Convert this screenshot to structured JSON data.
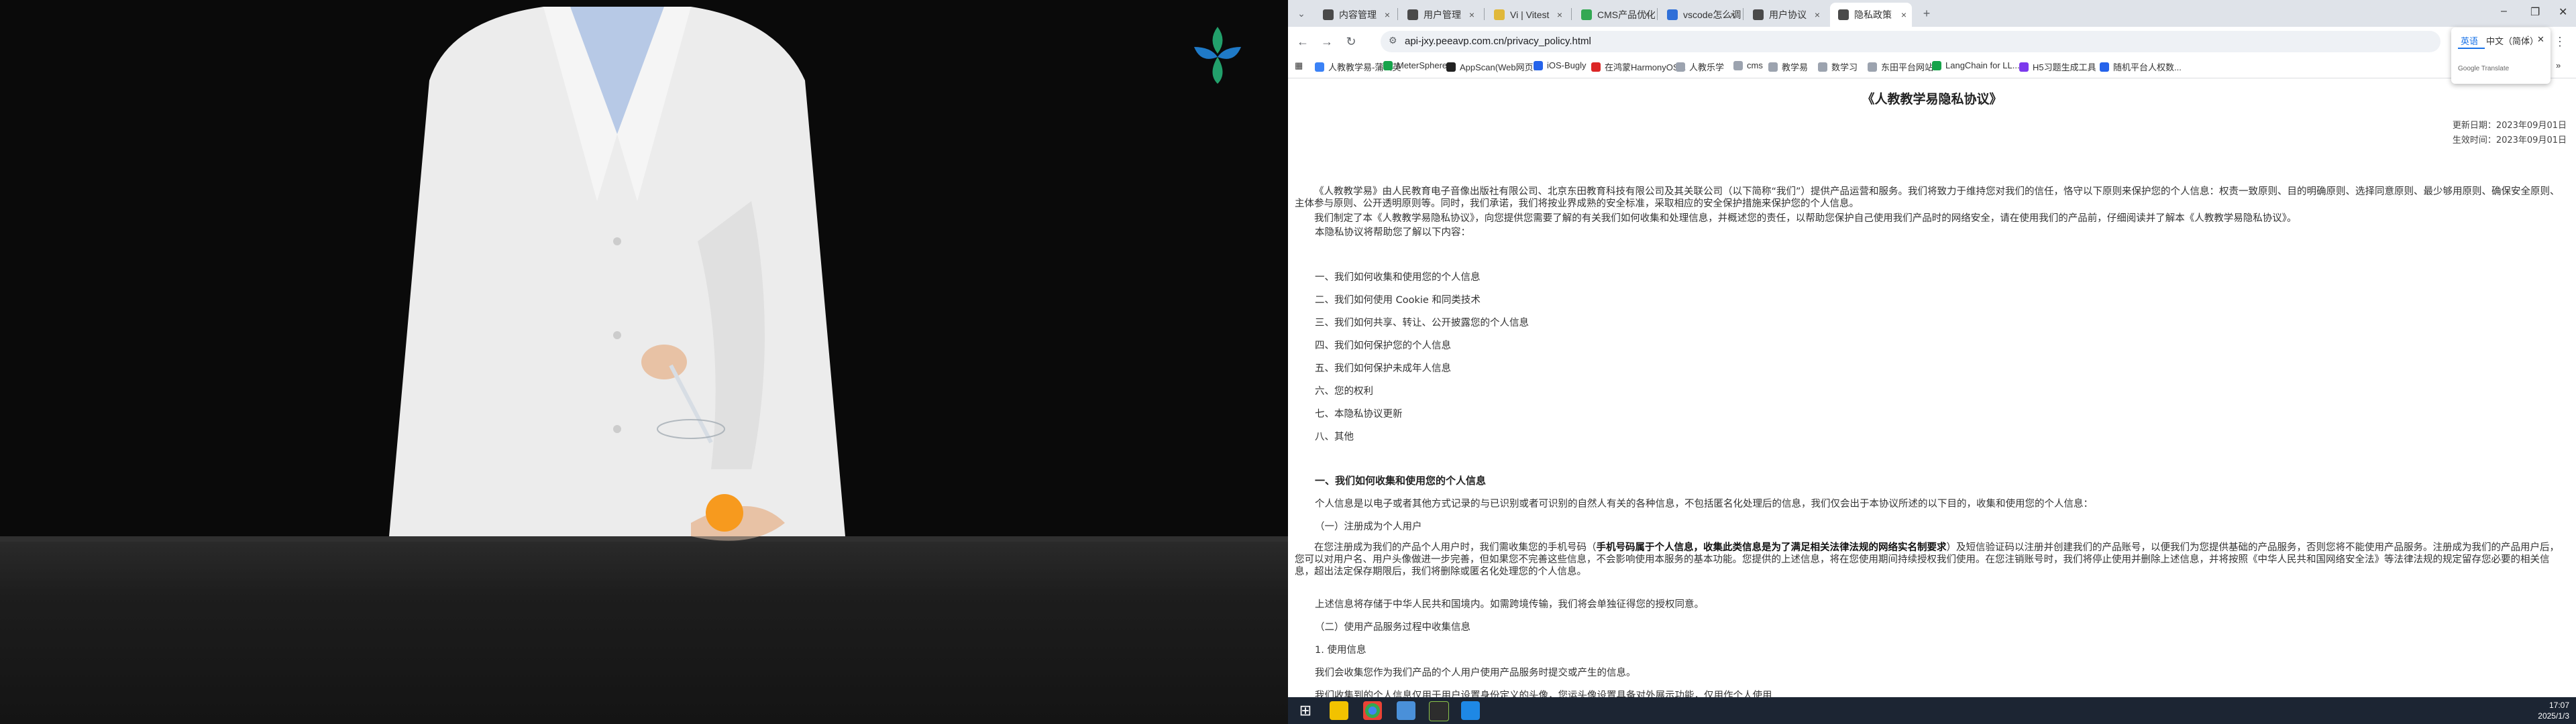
{
  "browser": {
    "tabs": [
      {
        "label": "内容管理",
        "color": "#4a4a4a"
      },
      {
        "label": "用户管理",
        "color": "#4a4a4a"
      },
      {
        "label": "Vi | Vitest",
        "color": "#e0b83a"
      },
      {
        "label": "CMS产品优化问题跟进",
        "color": "#33a853"
      },
      {
        "label": "vscode怎么调试啊 • Workflo",
        "color": "#2f6fd8"
      },
      {
        "label": "用户协议",
        "color": "#4a4a4a"
      },
      {
        "label": "隐私政策",
        "color": "#4a4a4a"
      }
    ],
    "url": "api-jxy.peeavp.com.cn/privacy_policy.html",
    "bookmarks": [
      {
        "label": "人教教学易-蒲公英",
        "color": "#3b82f6"
      },
      {
        "label": "MeterSphere",
        "color": "#16a34a"
      },
      {
        "label": "AppScan(Web网页...",
        "color": "#222"
      },
      {
        "label": "iOS-Bugly",
        "color": "#2563eb"
      },
      {
        "label": "在鸿蒙HarmonyOS...",
        "color": "#dc2626"
      },
      {
        "label": "人教乐学",
        "color": "#7c7c7c"
      },
      {
        "label": "cms",
        "color": "#7c7c7c"
      },
      {
        "label": "教学易",
        "color": "#7c7c7c"
      },
      {
        "label": "数学习",
        "color": "#7c7c7c"
      },
      {
        "label": "东田平台网站",
        "color": "#7c7c7c"
      },
      {
        "label": "LangChain for LL...",
        "color": "#16a34a"
      },
      {
        "label": "H5习题生成工具",
        "color": "#7c3aed"
      },
      {
        "label": "随机平台人权数...",
        "color": "#2563eb"
      }
    ],
    "translate": {
      "lang1": "英语",
      "lang2": "中文（简体）",
      "brand": "Google Translate"
    }
  },
  "doc": {
    "title": "《人教教学易隐私协议》",
    "updated": "更新日期：2023年09月01日",
    "effective": "生效时间：2023年09月01日",
    "intro1": "《人教教学易》由人民教育电子音像出版社有限公司、北京东田教育科技有限公司及其关联公司（以下简称“我们”）提供产品运营和服务。我们将致力于维持您对我们的信任，恪守以下原则来保护您的个人信息：权责一致原则、目的明确原则、选择同意原则、最少够用原则、确保安全原则、主体参与原则、公开透明原则等。同时，我们承诺，我们将按业界成熟的安全标准，采取相应的安全保护措施来保护您的个人信息。",
    "intro2": "我们制定了本《人教教学易隐私协议》，向您提供您需要了解的有关我们如何收集和处理信息，并概述您的责任，以帮助您保护自己使用我们产品时的网络安全，请在使用我们的产品前，仔细阅读并了解本《人教教学易隐私协议》。",
    "intro3": "本隐私协议将帮助您了解以下内容：",
    "toc": [
      "一、我们如何收集和使用您的个人信息",
      "二、我们如何使用 Cookie 和同类技术",
      "三、我们如何共享、转让、公开披露您的个人信息",
      "四、我们如何保护您的个人信息",
      "五、我们如何保护未成年人信息",
      "六、您的权利",
      "七、本隐私协议更新",
      "八、其他"
    ],
    "section1_title": "一、我们如何收集和使用您的个人信息",
    "section1_p1": "个人信息是以电子或者其他方式记录的与已识别或者可识别的自然人有关的各种信息，不包括匿名化处理后的信息，我们仅会出于本协议所述的以下目的，收集和使用您的个人信息：",
    "sub1": "（一）注册成为个人用户",
    "p_reg_a": "在您注册成为我们的产品个人用户时，我们需收集您的手机号码（",
    "p_reg_bold": "手机号码属于个人信息，收集此类信息是为了满足相关法律法规的网络实名制要求",
    "p_reg_b": "）及短信验证码以注册并创建我们的产品账号，以便我们为您提供基础的产品服务，否则您将不能使用产品服务。注册成为我们的产品用户后，您可以对用户名、用户头像做进一步完善，但如果您不完善这些信息，不会影响使用本服务的基本功能。您提供的上述信息，将在您使用期间持续授权我们使用。在您注销账号时，我们将停止使用并删除上述信息，并将按照《中华人民共和国网络安全法》等法律法规的规定留存您必要的相关信息，超出法定保存期限后，我们将删除或匿名化处理您的个人信息。",
    "p_store": "上述信息将存储于中华人民共和国境内。如需跨境传输，我们将会单独征得您的授权同意。",
    "sub2": "（二）使用产品服务过程中收集信息",
    "sub2_1": "1. 使用信息",
    "p_use": "我们会收集您作为我们产品的个人用户使用产品服务时提交或产生的信息。",
    "p_use_cut": "我们收集到的个人信息仅用于用户设置身份定义的头像，您运头像设置具备对外展示功能，仅用作个人使用"
  },
  "taskbar": {
    "time": "17:07",
    "date": "2025/1/3"
  }
}
